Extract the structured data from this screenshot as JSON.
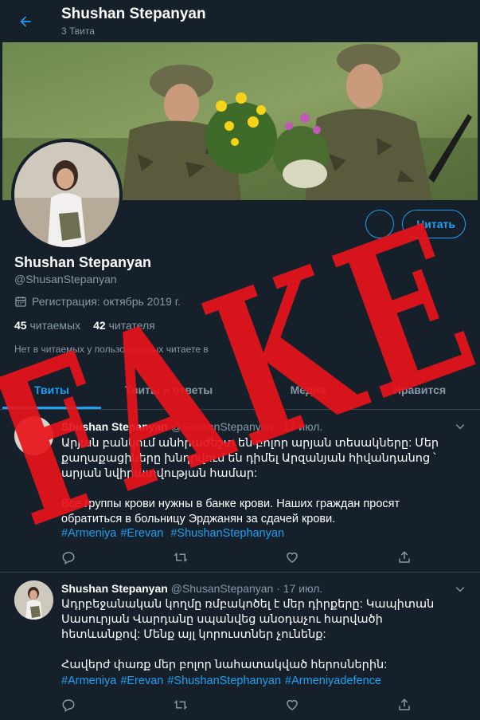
{
  "header": {
    "title": "Shushan Stepanyan",
    "tweet_count": "3 Твита"
  },
  "profile": {
    "name": "Shushan Stepanyan",
    "handle": "@ShusanStepanyan",
    "joined": "Регистрация: октябрь 2019 г.",
    "following_count": "45",
    "following_label": "читаемых",
    "followers_count": "42",
    "followers_label": "читателя",
    "mutuals_note": "Нет в читаемых у пользо        которых читаете в",
    "follow_button": "Читать"
  },
  "tabs": [
    {
      "label": "Твиты"
    },
    {
      "label": "Твиты и ответы"
    },
    {
      "label": "Медиа"
    },
    {
      "label": "Нравится"
    }
  ],
  "tweets": [
    {
      "name": "Shushan Stepanyan",
      "handle": "@ShusanStepanyan",
      "date": "· 17 июл.",
      "text": "Արյան բանկում անհրաժեշտ են բոլոր արյան տեսակները: Մեր քաղաքացիները խնդրվում են դիմել Արզանյան հիվանդանոց ՝ արյան նվիրատվության համար:\n\nВсе группы крови нужны в банке крови. Наших граждан просят обратиться в больницу Эрджанян за сдачей крови.",
      "tags": [
        "#Armeniya",
        "#Erevan",
        "#ShushanStephanyan"
      ]
    },
    {
      "name": "Shushan Stepanyan",
      "handle": "@ShusanStepanyan",
      "date": "· 17 июл.",
      "text": "Ադրբեջանական կողմը ռմբակոծել է մեր դիրքերը: Կապիտան Սասուրյան Վարդանը սպանվեց անօդաչու հարվածի հետևանքով: Մենք այլ կորուստներ չունենք:\n\nՀավերժ փառք մեր բոլոր նահատակված հերոսներին:",
      "tags": [
        "#Armeniya",
        "#Erevan",
        "#ShushanStephanyan",
        "#Armeniyadefence"
      ]
    }
  ],
  "watermark": "FAKE",
  "colors": {
    "background": "#15202b",
    "accent": "#1da1f2",
    "muted": "#8899a6",
    "stamp": "#e8141b"
  }
}
